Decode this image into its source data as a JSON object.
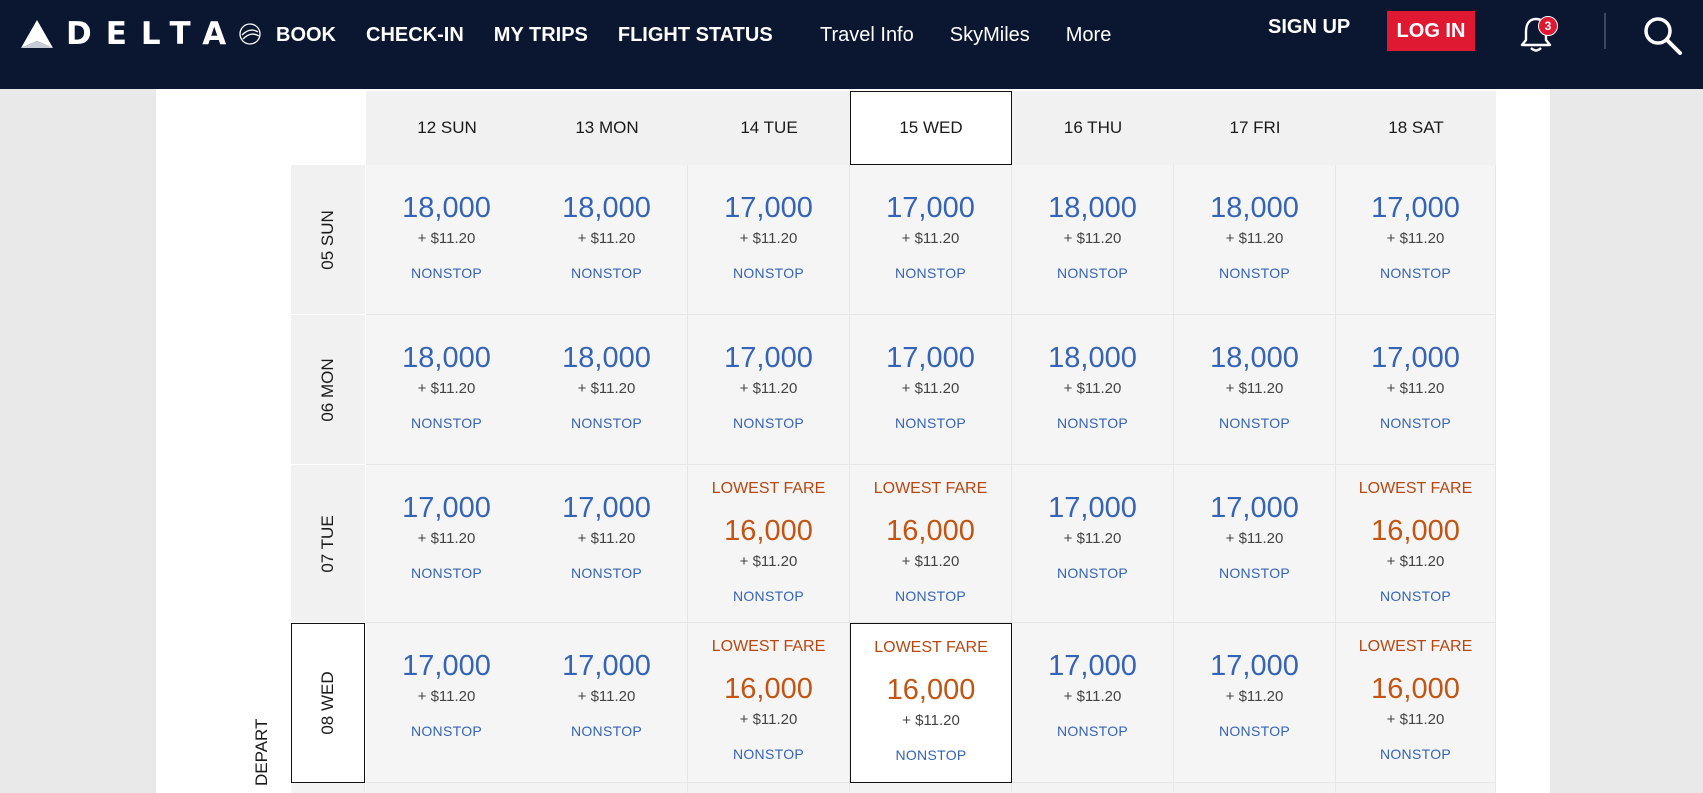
{
  "header": {
    "brand": "DELTA",
    "nav_main": [
      "BOOK",
      "CHECK-IN",
      "MY TRIPS",
      "FLIGHT STATUS"
    ],
    "nav_secondary": [
      "Travel Info",
      "SkyMiles",
      "More"
    ],
    "sign_up": "SIGN UP",
    "log_in": "LOG IN",
    "notification_count": "3",
    "icons": [
      "delta-widget-icon",
      "skyteam-icon",
      "bell-icon",
      "search-icon"
    ],
    "colors": {
      "bar": "#0b1630",
      "login": "#e01933"
    }
  },
  "grid": {
    "axis_label": "DEPART",
    "columns": [
      "12 SUN",
      "13 MON",
      "14 TUE",
      "15 WED",
      "16 THU",
      "17 FRI",
      "18 SAT"
    ],
    "selected_column": "15 WED",
    "selected_row": "08 WED",
    "rows": [
      {
        "label": "05 SUN",
        "cells": [
          {
            "miles": "18,000",
            "tax": "+ $11.20",
            "stops": "NONSTOP",
            "lowest": ""
          },
          {
            "miles": "18,000",
            "tax": "+ $11.20",
            "stops": "NONSTOP",
            "lowest": ""
          },
          {
            "miles": "17,000",
            "tax": "+ $11.20",
            "stops": "NONSTOP",
            "lowest": ""
          },
          {
            "miles": "17,000",
            "tax": "+ $11.20",
            "stops": "NONSTOP",
            "lowest": ""
          },
          {
            "miles": "18,000",
            "tax": "+ $11.20",
            "stops": "NONSTOP",
            "lowest": ""
          },
          {
            "miles": "18,000",
            "tax": "+ $11.20",
            "stops": "NONSTOP",
            "lowest": ""
          },
          {
            "miles": "17,000",
            "tax": "+ $11.20",
            "stops": "NONSTOP",
            "lowest": ""
          }
        ]
      },
      {
        "label": "06 MON",
        "cells": [
          {
            "miles": "18,000",
            "tax": "+ $11.20",
            "stops": "NONSTOP",
            "lowest": ""
          },
          {
            "miles": "18,000",
            "tax": "+ $11.20",
            "stops": "NONSTOP",
            "lowest": ""
          },
          {
            "miles": "17,000",
            "tax": "+ $11.20",
            "stops": "NONSTOP",
            "lowest": ""
          },
          {
            "miles": "17,000",
            "tax": "+ $11.20",
            "stops": "NONSTOP",
            "lowest": ""
          },
          {
            "miles": "18,000",
            "tax": "+ $11.20",
            "stops": "NONSTOP",
            "lowest": ""
          },
          {
            "miles": "18,000",
            "tax": "+ $11.20",
            "stops": "NONSTOP",
            "lowest": ""
          },
          {
            "miles": "17,000",
            "tax": "+ $11.20",
            "stops": "NONSTOP",
            "lowest": ""
          }
        ]
      },
      {
        "label": "07 TUE",
        "cells": [
          {
            "miles": "17,000",
            "tax": "+ $11.20",
            "stops": "NONSTOP",
            "lowest": ""
          },
          {
            "miles": "17,000",
            "tax": "+ $11.20",
            "stops": "NONSTOP",
            "lowest": ""
          },
          {
            "miles": "16,000",
            "tax": "+ $11.20",
            "stops": "NONSTOP",
            "lowest": "LOWEST FARE"
          },
          {
            "miles": "16,000",
            "tax": "+ $11.20",
            "stops": "NONSTOP",
            "lowest": "LOWEST FARE"
          },
          {
            "miles": "17,000",
            "tax": "+ $11.20",
            "stops": "NONSTOP",
            "lowest": ""
          },
          {
            "miles": "17,000",
            "tax": "+ $11.20",
            "stops": "NONSTOP",
            "lowest": ""
          },
          {
            "miles": "16,000",
            "tax": "+ $11.20",
            "stops": "NONSTOP",
            "lowest": "LOWEST FARE"
          }
        ]
      },
      {
        "label": "08 WED",
        "cells": [
          {
            "miles": "17,000",
            "tax": "+ $11.20",
            "stops": "NONSTOP",
            "lowest": ""
          },
          {
            "miles": "17,000",
            "tax": "+ $11.20",
            "stops": "NONSTOP",
            "lowest": ""
          },
          {
            "miles": "16,000",
            "tax": "+ $11.20",
            "stops": "NONSTOP",
            "lowest": "LOWEST FARE"
          },
          {
            "miles": "16,000",
            "tax": "+ $11.20",
            "stops": "NONSTOP",
            "lowest": "LOWEST FARE"
          },
          {
            "miles": "17,000",
            "tax": "+ $11.20",
            "stops": "NONSTOP",
            "lowest": ""
          },
          {
            "miles": "17,000",
            "tax": "+ $11.20",
            "stops": "NONSTOP",
            "lowest": ""
          },
          {
            "miles": "16,000",
            "tax": "+ $11.20",
            "stops": "NONSTOP",
            "lowest": "LOWEST FARE"
          }
        ]
      }
    ]
  }
}
